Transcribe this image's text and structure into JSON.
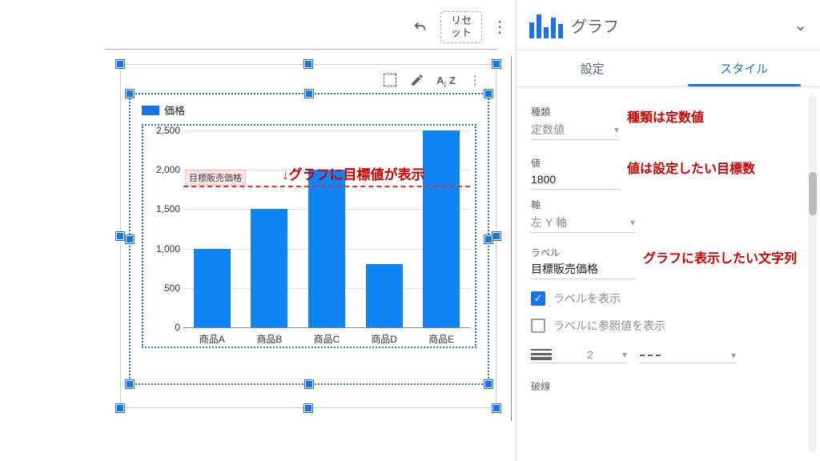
{
  "toolbar": {
    "reset_label": "リセット"
  },
  "panel": {
    "title": "グラフ",
    "tab_setup": "設定",
    "tab_style": "スタイル",
    "type_label": "種類",
    "type_value": "定数値",
    "value_label": "値",
    "value_value": "1800",
    "axis_label": "軸",
    "axis_value": "左 Y 軸",
    "label_label": "ラベル",
    "label_value": "目標販売価格",
    "show_label_cb": "ラベルを表示",
    "show_ref_value_cb": "ラベルに参照値を表示",
    "thickness_value": "2",
    "last_truncated": "破線"
  },
  "annotations": {
    "chart_anno": "↓グラフに目標値が表示",
    "type_anno": "種類は定数値",
    "value_anno": "値は設定したい目標数",
    "label_anno": "グラフに表示したい文字列"
  },
  "chart_data": {
    "type": "bar",
    "legend_label": "価格",
    "categories": [
      "商品A",
      "商品B",
      "商品C",
      "商品D",
      "商品E"
    ],
    "values": [
      1000,
      1500,
      2000,
      800,
      2500
    ],
    "ylim": [
      0,
      2500
    ],
    "yticks": [
      0,
      500,
      1000,
      1500,
      2000,
      2500
    ],
    "reference_line": {
      "value": 1800,
      "label": "目標販売価格"
    }
  }
}
